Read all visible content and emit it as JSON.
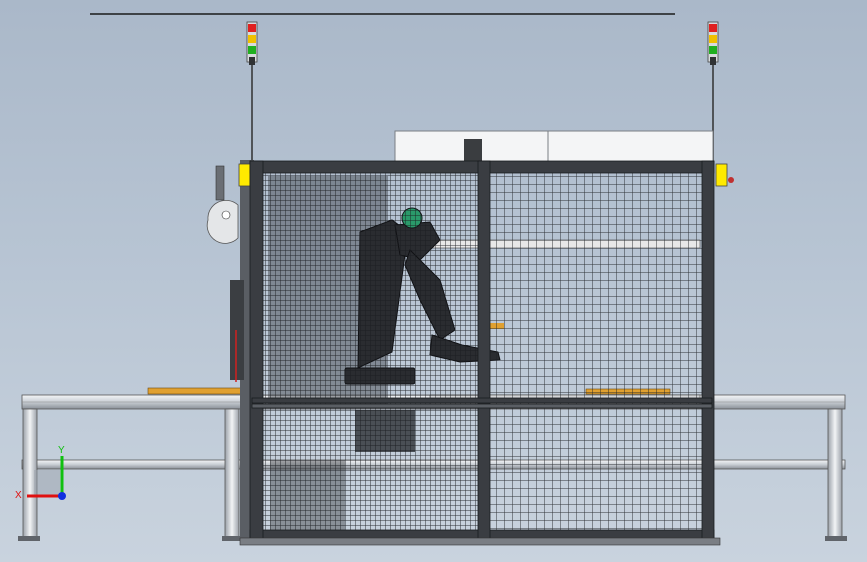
{
  "viewport": {
    "background_top": "#aab8c9",
    "background_bottom": "#c9d3de"
  },
  "triad": {
    "x_label": "X",
    "y_label": "Y",
    "x_color": "#e01010",
    "y_color": "#10c010",
    "z_color": "#1030e0"
  },
  "stack_lights": {
    "colors": [
      "#e02020",
      "#f0c000",
      "#20b020"
    ]
  },
  "colors": {
    "frame": "#3a3d42",
    "mesh": "#1f2226",
    "conveyor": "#e6e8ea",
    "robot": "#2a2c30",
    "sensor_yellow": "#ffea00",
    "orange_part": "#e0a030"
  }
}
